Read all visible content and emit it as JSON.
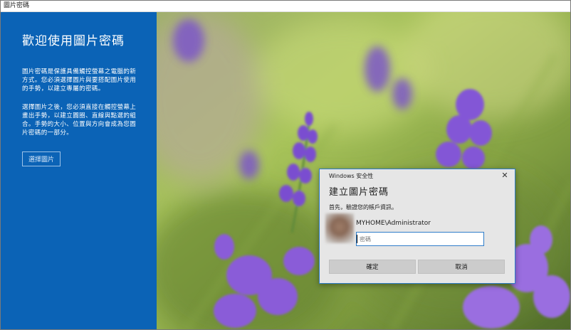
{
  "window": {
    "title": "圖片密碼"
  },
  "left_panel": {
    "title": "歡迎使用圖片密碼",
    "paragraph1": "圖片密碼是保護具備觸控螢幕之電腦的新方式。您必須選擇圖片與要搭配圖片使用的手勢，以建立專屬的密碼。",
    "paragraph2": "選擇圖片之後，您必須直接在觸控螢幕上畫出手勢，以建立圓圈、直線與點選的組合。手勢的大小、位置與方向會成為您圖片密碼的一部分。",
    "choose_picture_label": "選擇圖片"
  },
  "dialog": {
    "caption": "Windows 安全性",
    "close_glyph": "✕",
    "heading": "建立圖片密碼",
    "instruction": "首先，驗證您的帳戶資訊。",
    "username": "MYHOME\\Administrator",
    "password_value": "",
    "password_placeholder": "密碼",
    "ok_label": "確定",
    "cancel_label": "取消"
  },
  "colors": {
    "accent_blue": "#0b63b6",
    "dialog_border": "#2f7dc9",
    "flower_purple": "#7b4fd0"
  }
}
